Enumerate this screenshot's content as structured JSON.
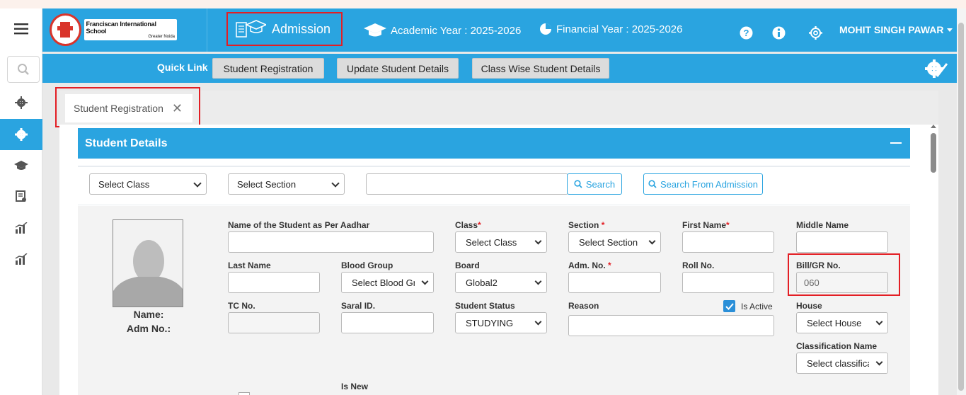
{
  "header": {
    "school_name": "Franciscan International School",
    "school_location": "Greater Noida",
    "module": "Admission",
    "academic_year": "Academic Year : 2025-2026",
    "financial_year": "Financial Year : 2025-2026",
    "user_name": "MOHIT SINGH PAWAR"
  },
  "quick_links": {
    "label": "Quick Link",
    "items": [
      "Student Registration",
      "Update Student Details",
      "Class Wise Student Details"
    ]
  },
  "tab": {
    "label": "Student Registration"
  },
  "section": {
    "title": "Student Details"
  },
  "search": {
    "class_select": "Select Class",
    "section_select": "Select Section",
    "query": "",
    "search_button": "Search",
    "search_admission_button": "Search From Admission"
  },
  "photo": {
    "name_label": "Name:",
    "adm_label": "Adm No.:"
  },
  "form": {
    "aadhar_name": {
      "label": "Name of the Student as Per Aadhar",
      "value": ""
    },
    "class": {
      "label": "Class",
      "value": "Select Class"
    },
    "section": {
      "label": "Section ",
      "value": "Select Section"
    },
    "first_name": {
      "label": "First Name",
      "value": ""
    },
    "middle_name": {
      "label": "Middle Name",
      "value": ""
    },
    "last_name": {
      "label": "Last Name",
      "value": ""
    },
    "blood_group": {
      "label": "Blood Group",
      "value": "Select Blood Group"
    },
    "board": {
      "label": "Board",
      "value": "Global2"
    },
    "adm_no": {
      "label": "Adm. No. ",
      "value": ""
    },
    "roll_no": {
      "label": "Roll No.",
      "value": ""
    },
    "bill_gr_no": {
      "label": "Bill/GR No.",
      "value": "060"
    },
    "tc_no": {
      "label": "TC No.",
      "value": ""
    },
    "saral_id": {
      "label": "Saral ID.",
      "value": ""
    },
    "student_status": {
      "label": "Student Status",
      "value": "STUDYING"
    },
    "reason": {
      "label": "Reason",
      "value": ""
    },
    "is_active": {
      "label": "Is Active",
      "checked": true
    },
    "house": {
      "label": "House",
      "value": "Select House"
    },
    "classification": {
      "label": "Classification Name",
      "value": "Select classification"
    },
    "is_new": {
      "label": "Is New"
    }
  },
  "colors": {
    "primary": "#2aa4e0",
    "highlight": "#e31e24"
  }
}
